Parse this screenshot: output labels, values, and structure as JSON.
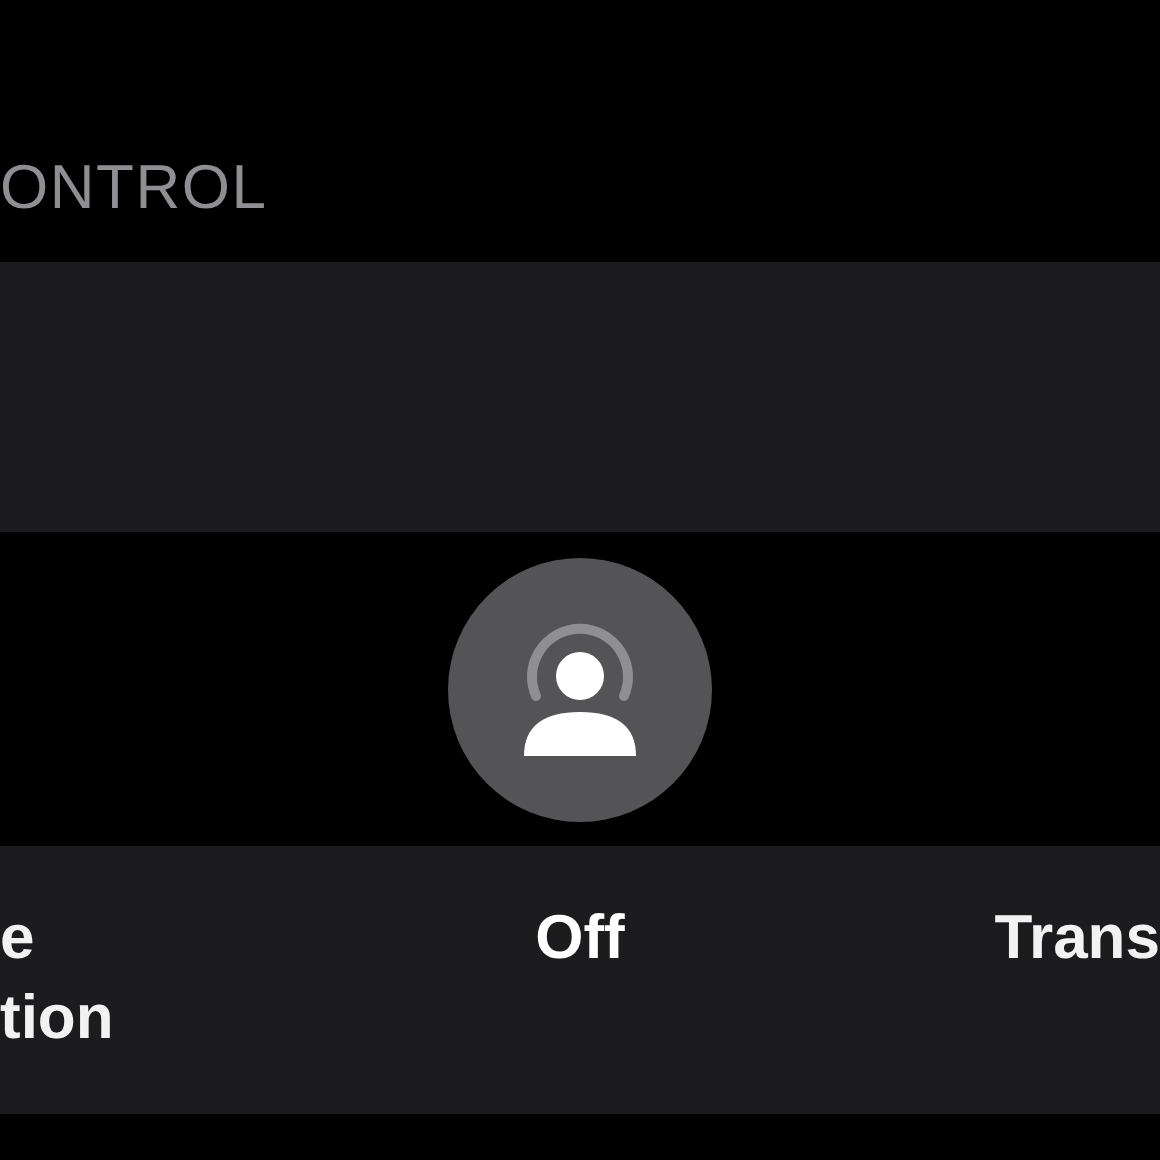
{
  "section_header": "ONTROL",
  "modes": [
    {
      "lines": [
        "e",
        "tion"
      ],
      "selected": false
    },
    {
      "lines": [
        "Off"
      ],
      "selected": true
    },
    {
      "lines": [
        "Trans"
      ],
      "selected": false
    }
  ]
}
